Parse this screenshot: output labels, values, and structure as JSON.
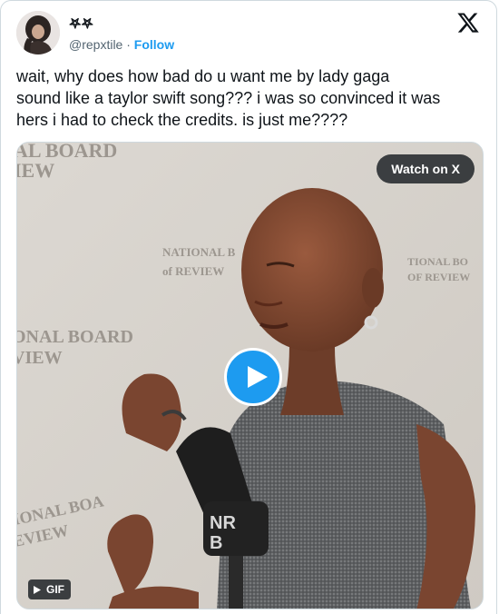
{
  "tweet": {
    "author_name": "𖤐𖤐",
    "handle": "@repxtile",
    "separator": "·",
    "follow_label": "Follow",
    "text": "wait, why does how bad do u want me by lady gaga\nsound like a taylor swift song??? i was so convinced it was\nhers i had to check the credits. is just me????"
  },
  "media": {
    "watch_label": "Watch on X",
    "gif_label": "GIF",
    "backdrop_text": {
      "top_left_1": "AL BOARD",
      "top_left_2": "IEW",
      "center_1": "NATIONAL B",
      "center_2": "of REVIEW",
      "mid_left_1": "ONAL BOARD",
      "mid_left_2": "VIEW",
      "bottom_left_1": "IONAL BOA",
      "bottom_left_2": "EVIEW",
      "right_1": "TIONAL BO",
      "right_2": "OF REVIEW"
    }
  },
  "colors": {
    "accent": "#1d9bf0",
    "text": "#0f1419",
    "muted": "#536471"
  },
  "icons": [
    "x-logo-icon",
    "play-icon",
    "gif-play-icon"
  ]
}
